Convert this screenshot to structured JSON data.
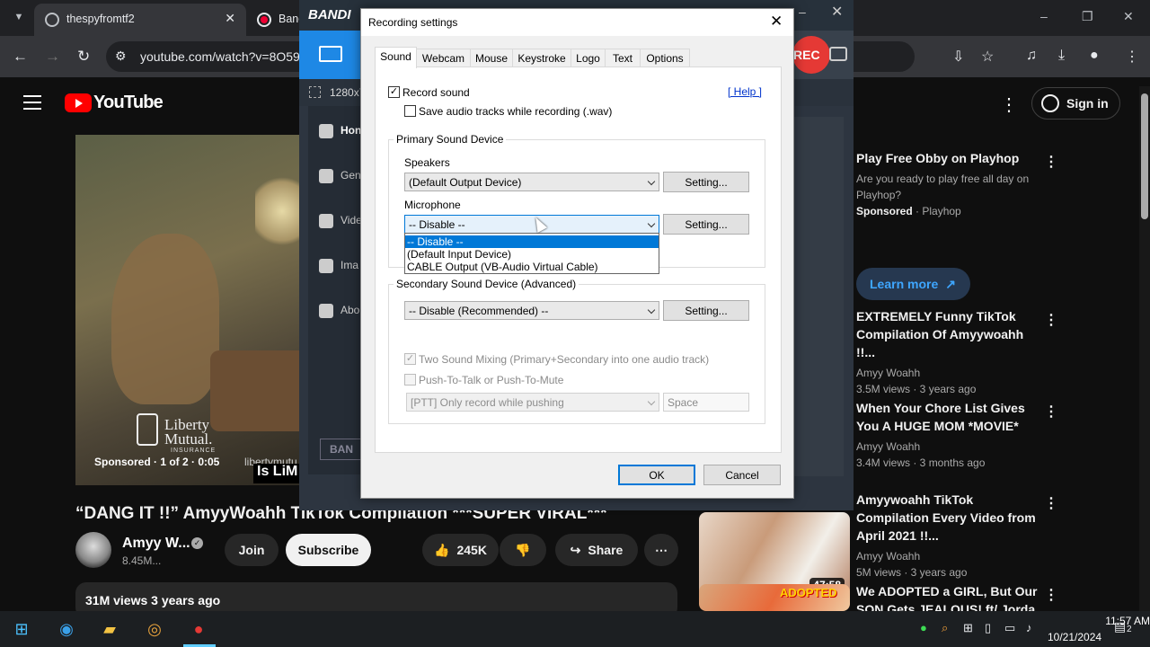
{
  "browser": {
    "tab1_title": "thespyfromtf2",
    "tab2_title": "Bane",
    "url": "youtube.com/watch?v=8O59",
    "search_tabs_icon": "chevron-down-icon",
    "min_icon": "–",
    "restore_icon": "❐",
    "close_icon": "✕"
  },
  "youtube": {
    "logo_text": "YouTube",
    "sign_in": "Sign in",
    "video": {
      "sponsored": "Sponsored · 1 of 2 · 0:05",
      "ad_url": "libertymutu",
      "overlay_title": "Is LiM",
      "brand_line1": "Liberty",
      "brand_line2": "Mutual.",
      "brand_sub": "INSURANCE"
    },
    "title": "“DANG IT !!” AmyyWoahh TikTok Compilation ***SUPER VIRAL***",
    "channel": "Amyy W...",
    "subscribers": "8.45M...",
    "join": "Join",
    "subscribe": "Subscribe",
    "likes": "245K",
    "share": "Share",
    "views": "31M views  3 years ago",
    "recommendations": [
      {
        "title": "Play Free Obby on Playhop",
        "desc": "Are you ready to play free all day on Playhop?",
        "sponsor": "Sponsored",
        "advertiser": "Playhop"
      },
      {
        "learn_more": "Learn more"
      },
      {
        "title": "EXTREMELY Funny TikTok Compilation Of Amyywoahh !!...",
        "channel": "Amyy Woahh",
        "meta": "3.5M views · 3 years ago"
      },
      {
        "title": "When Your Chore List Gives You A HUGE MOM *MOVIE*",
        "channel": "Amyy Woahh",
        "meta": "3.4M views · 3 months ago"
      },
      {
        "title": "Amyywoahh TikTok Compilation Every Video from April 2021 !!...",
        "channel": "Amyy Woahh",
        "meta": "5M views · 3 years ago",
        "duration": "47:58"
      },
      {
        "title": "We ADOPTED a GIRL, But Our SON Gets JEALOUS! ft/ Jorda",
        "thumb_text": "ADOPTED"
      }
    ]
  },
  "bandicam": {
    "logo": "BANDI",
    "rec": "REC",
    "size": "1280x7",
    "sidebar": [
      "Hon",
      "Gen",
      "Vide",
      "Ima",
      "Abo"
    ],
    "bottom_logo": "BAN"
  },
  "dialog": {
    "title": "Recording settings",
    "tabs": [
      "Sound",
      "Webcam",
      "Mouse",
      "Keystroke",
      "Logo",
      "Text",
      "Options"
    ],
    "record_sound": "Record sound",
    "save_wav": "Save audio tracks while recording (.wav)",
    "help": "[ Help ]",
    "primary_group": "Primary Sound Device",
    "speakers_label": "Speakers",
    "speakers_value": "(Default Output Device)",
    "microphone_label": "Microphone",
    "microphone_value": "-- Disable --",
    "mic_options": [
      "-- Disable --",
      "(Default Input Device)",
      "CABLE Output (VB-Audio Virtual Cable)"
    ],
    "setting_btn": "Setting...",
    "secondary_group": "Secondary Sound Device (Advanced)",
    "secondary_value": "-- Disable (Recommended) --",
    "two_sound_mixing": "Two Sound Mixing (Primary+Secondary into one audio track)",
    "push_to_talk": "Push-To-Talk or Push-To-Mute",
    "ptt_value": "[PTT] Only record while pushing",
    "hotkey": "Space",
    "ok": "OK",
    "cancel": "Cancel"
  },
  "taskbar": {
    "time": "11:57 AM",
    "date": "10/21/2024",
    "notifications": "2"
  }
}
